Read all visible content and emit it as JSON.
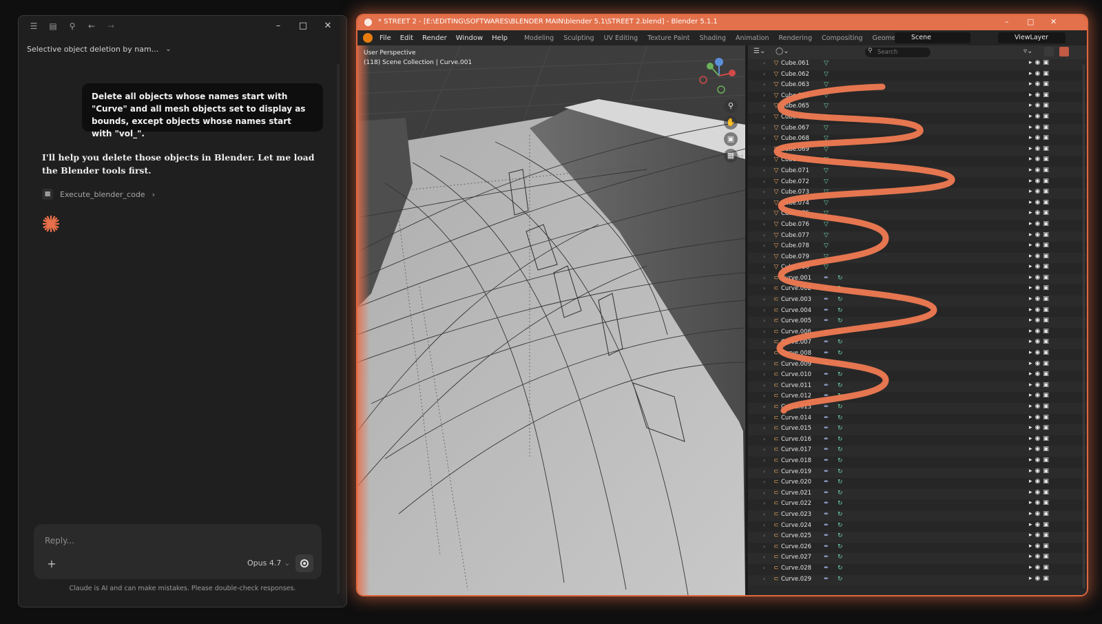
{
  "claude": {
    "conversation_title": "Selective object deletion by nam...",
    "user_message": "Delete all objects whose names start with \"Curve\" and all mesh objects set to display as bounds, except objects whose names start with \"vol_\".",
    "assistant_message": "I'll help you delete those objects in Blender. Let me load the Blender tools first.",
    "tool_call_label": "Execute_blender_code",
    "reply_placeholder": "Reply...",
    "model_label": "Opus 4.7",
    "disclaimer": "Claude is AI and can make mistakes. Please double-check responses.",
    "accent_color": "#e8704a"
  },
  "blender": {
    "title": "* STREET 2 - [E:\\EDITING\\SOFTWARES\\BLENDER MAIN\\blender 5.1\\STREET 2.blend] - Blender 5.1.1",
    "menus": [
      "File",
      "Edit",
      "Render",
      "Window",
      "Help"
    ],
    "workspaces": [
      "Modeling",
      "Sculpting",
      "UV Editing",
      "Texture Paint",
      "Shading",
      "Animation",
      "Rendering",
      "Compositing",
      "Geometry Nodes"
    ],
    "scene": "Scene",
    "view_layer": "ViewLayer",
    "viewport": {
      "perspective": "User Perspective",
      "collection": "(118) Scene Collection | Curve.001"
    },
    "outliner": {
      "search_placeholder": "Search",
      "rows": [
        {
          "name": "Cube.061",
          "type": "mesh"
        },
        {
          "name": "Cube.062",
          "type": "mesh"
        },
        {
          "name": "Cube.063",
          "type": "mesh"
        },
        {
          "name": "Cube.064",
          "type": "mesh"
        },
        {
          "name": "Cube.065",
          "type": "mesh"
        },
        {
          "name": "Cube.066",
          "type": "mesh"
        },
        {
          "name": "Cube.067",
          "type": "mesh"
        },
        {
          "name": "Cube.068",
          "type": "mesh"
        },
        {
          "name": "Cube.069",
          "type": "mesh"
        },
        {
          "name": "Cube.070",
          "type": "mesh"
        },
        {
          "name": "Cube.071",
          "type": "mesh"
        },
        {
          "name": "Cube.072",
          "type": "mesh"
        },
        {
          "name": "Cube.073",
          "type": "mesh"
        },
        {
          "name": "Cube.074",
          "type": "mesh"
        },
        {
          "name": "Cube.075",
          "type": "mesh"
        },
        {
          "name": "Cube.076",
          "type": "mesh"
        },
        {
          "name": "Cube.077",
          "type": "mesh"
        },
        {
          "name": "Cube.078",
          "type": "mesh"
        },
        {
          "name": "Cube.079",
          "type": "mesh"
        },
        {
          "name": "Cube.080",
          "type": "mesh"
        },
        {
          "name": "Curve.001",
          "type": "curve"
        },
        {
          "name": "Curve.002",
          "type": "curve"
        },
        {
          "name": "Curve.003",
          "type": "curve"
        },
        {
          "name": "Curve.004",
          "type": "curve"
        },
        {
          "name": "Curve.005",
          "type": "curve"
        },
        {
          "name": "Curve.006",
          "type": "curve"
        },
        {
          "name": "Curve.007",
          "type": "curve"
        },
        {
          "name": "Curve.008",
          "type": "curve"
        },
        {
          "name": "Curve.009",
          "type": "curve"
        },
        {
          "name": "Curve.010",
          "type": "curve"
        },
        {
          "name": "Curve.011",
          "type": "curve"
        },
        {
          "name": "Curve.012",
          "type": "curve"
        },
        {
          "name": "Curve.013",
          "type": "curve"
        },
        {
          "name": "Curve.014",
          "type": "curve"
        },
        {
          "name": "Curve.015",
          "type": "curve"
        },
        {
          "name": "Curve.016",
          "type": "curve"
        },
        {
          "name": "Curve.017",
          "type": "curve"
        },
        {
          "name": "Curve.018",
          "type": "curve"
        },
        {
          "name": "Curve.019",
          "type": "curve"
        },
        {
          "name": "Curve.020",
          "type": "curve"
        },
        {
          "name": "Curve.021",
          "type": "curve"
        },
        {
          "name": "Curve.022",
          "type": "curve"
        },
        {
          "name": "Curve.023",
          "type": "curve"
        },
        {
          "name": "Curve.024",
          "type": "curve"
        },
        {
          "name": "Curve.025",
          "type": "curve"
        },
        {
          "name": "Curve.026",
          "type": "curve"
        },
        {
          "name": "Curve.027",
          "type": "curve"
        },
        {
          "name": "Curve.028",
          "type": "curve"
        },
        {
          "name": "Curve.029",
          "type": "curve"
        }
      ]
    }
  }
}
